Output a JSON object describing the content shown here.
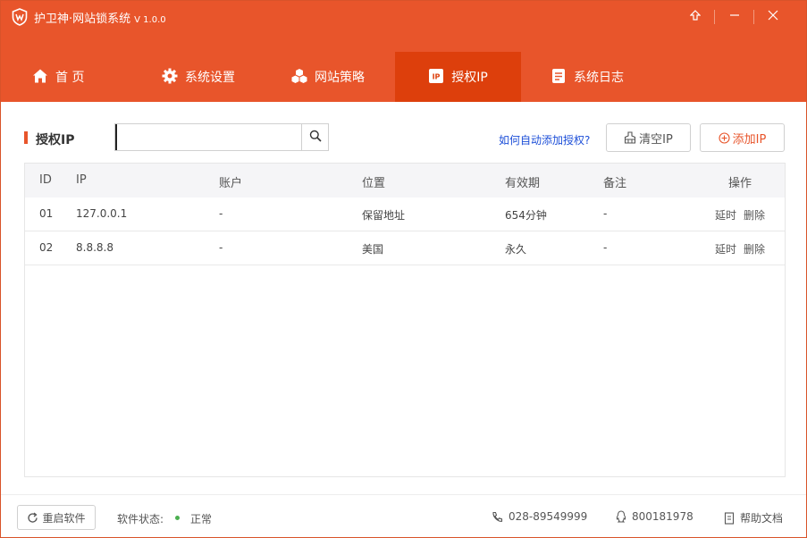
{
  "window": {
    "title": "护卫神·网站锁系统",
    "version": "V 1.0.0",
    "controls": {
      "upgrade": "upgrade-icon",
      "minimize": "minimize-icon",
      "close": "close-icon"
    }
  },
  "nav": {
    "items": [
      {
        "label": "首 页",
        "icon": "home-icon"
      },
      {
        "label": "系统设置",
        "icon": "gear-icon"
      },
      {
        "label": "网站策略",
        "icon": "cubes-icon"
      },
      {
        "label": "授权IP",
        "icon": "ip-icon",
        "active": true
      },
      {
        "label": "系统日志",
        "icon": "log-icon"
      }
    ]
  },
  "toolbar": {
    "section_title": "授权IP",
    "search_value": "",
    "help_link": "如何自动添加授权?",
    "clear_label": "清空IP",
    "add_label": "添加IP"
  },
  "table": {
    "columns": [
      "ID",
      "IP",
      "账户",
      "位置",
      "有效期",
      "备注",
      "操作"
    ],
    "rows": [
      {
        "id": "01",
        "ip": "127.0.0.1",
        "account": "-",
        "location": "保留地址",
        "validity": "654分钟",
        "note": "-",
        "extend": "延时",
        "delete": "删除"
      },
      {
        "id": "02",
        "ip": "8.8.8.8",
        "account": "-",
        "location": "美国",
        "validity": "永久",
        "note": "-",
        "extend": "延时",
        "delete": "删除"
      }
    ]
  },
  "footer": {
    "restart_label": "重启软件",
    "status_label": "软件状态:",
    "status_value": "正常",
    "phone": "028-89549999",
    "qq": "800181978",
    "help_docs": "帮助文档"
  },
  "colors": {
    "brand": "#e8552b",
    "active_tab": "#dd3f0c",
    "link": "#1d4fd8",
    "status_ok": "#4caf50"
  }
}
